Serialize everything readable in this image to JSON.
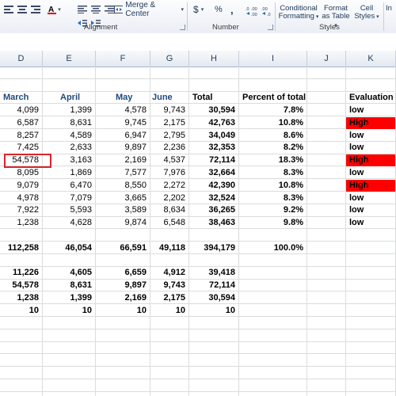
{
  "ribbon": {
    "merge_center_label": "Merge & Center",
    "currency_symbol": "$",
    "percent_symbol": "%",
    "comma_symbol": ",",
    "conditional_formatting_line1": "Conditional",
    "conditional_formatting_line2": "Formatting",
    "format_as_table_line1": "Format",
    "format_as_table_line2": "as Table",
    "cell_styles_line1": "Cell",
    "cell_styles_line2": "Styles",
    "insert_partial": "In",
    "groups": {
      "alignment": "Alignment",
      "number": "Number",
      "styles": "Styles"
    }
  },
  "column_headers": [
    "D",
    "E",
    "F",
    "G",
    "H",
    "I",
    "J",
    "K"
  ],
  "header_row": [
    "March",
    "April",
    "May",
    "June",
    "Total",
    "Percent of total",
    "",
    "Evaluation"
  ],
  "data_rows": [
    {
      "march": "4,099",
      "april": "1,399",
      "may": "4,578",
      "june": "9,743",
      "total": "30,594",
      "pct": "7.8%",
      "eval": "low",
      "high": false
    },
    {
      "march": "6,587",
      "april": "8,631",
      "may": "9,745",
      "june": "2,175",
      "total": "42,763",
      "pct": "10.8%",
      "eval": "High",
      "high": true
    },
    {
      "march": "8,257",
      "april": "4,589",
      "may": "6,947",
      "june": "2,795",
      "total": "34,049",
      "pct": "8.6%",
      "eval": "low",
      "high": false
    },
    {
      "march": "7,425",
      "april": "2,633",
      "may": "9,897",
      "june": "2,236",
      "total": "32,353",
      "pct": "8.2%",
      "eval": "low",
      "high": false
    },
    {
      "march": "54,578",
      "april": "3,163",
      "may": "2,169",
      "june": "4,537",
      "total": "72,114",
      "pct": "18.3%",
      "eval": "High",
      "high": true
    },
    {
      "march": "8,095",
      "april": "1,869",
      "may": "7,577",
      "june": "7,976",
      "total": "32,664",
      "pct": "8.3%",
      "eval": "low",
      "high": false
    },
    {
      "march": "9,079",
      "april": "6,470",
      "may": "8,550",
      "june": "2,272",
      "total": "42,390",
      "pct": "10.8%",
      "eval": "High",
      "high": true
    },
    {
      "march": "4,978",
      "april": "7,079",
      "may": "3,665",
      "june": "2,202",
      "total": "32,524",
      "pct": "8.3%",
      "eval": "low",
      "high": false
    },
    {
      "march": "7,922",
      "april": "5,593",
      "may": "3,589",
      "june": "8,634",
      "total": "36,265",
      "pct": "9.2%",
      "eval": "low",
      "high": false
    },
    {
      "march": "1,238",
      "april": "4,628",
      "may": "9,874",
      "june": "6,548",
      "total": "38,463",
      "pct": "9.8%",
      "eval": "low",
      "high": false
    }
  ],
  "total_row": {
    "march": "112,258",
    "april": "46,054",
    "may": "66,591",
    "june": "49,118",
    "total": "394,179",
    "pct": "100.0%"
  },
  "stats_rows": [
    {
      "march": "11,226",
      "april": "4,605",
      "may": "6,659",
      "june": "4,912",
      "total": "39,418"
    },
    {
      "march": "54,578",
      "april": "8,631",
      "may": "9,897",
      "june": "9,743",
      "total": "72,114"
    },
    {
      "march": "1,238",
      "april": "1,399",
      "may": "2,169",
      "june": "2,175",
      "total": "30,594"
    },
    {
      "march": "10",
      "april": "10",
      "may": "10",
      "june": "10",
      "total": "10"
    }
  ],
  "colors": {
    "high_fill": "#ff0000",
    "header_text": "#1f497d",
    "selection_border": "#d7262b"
  }
}
